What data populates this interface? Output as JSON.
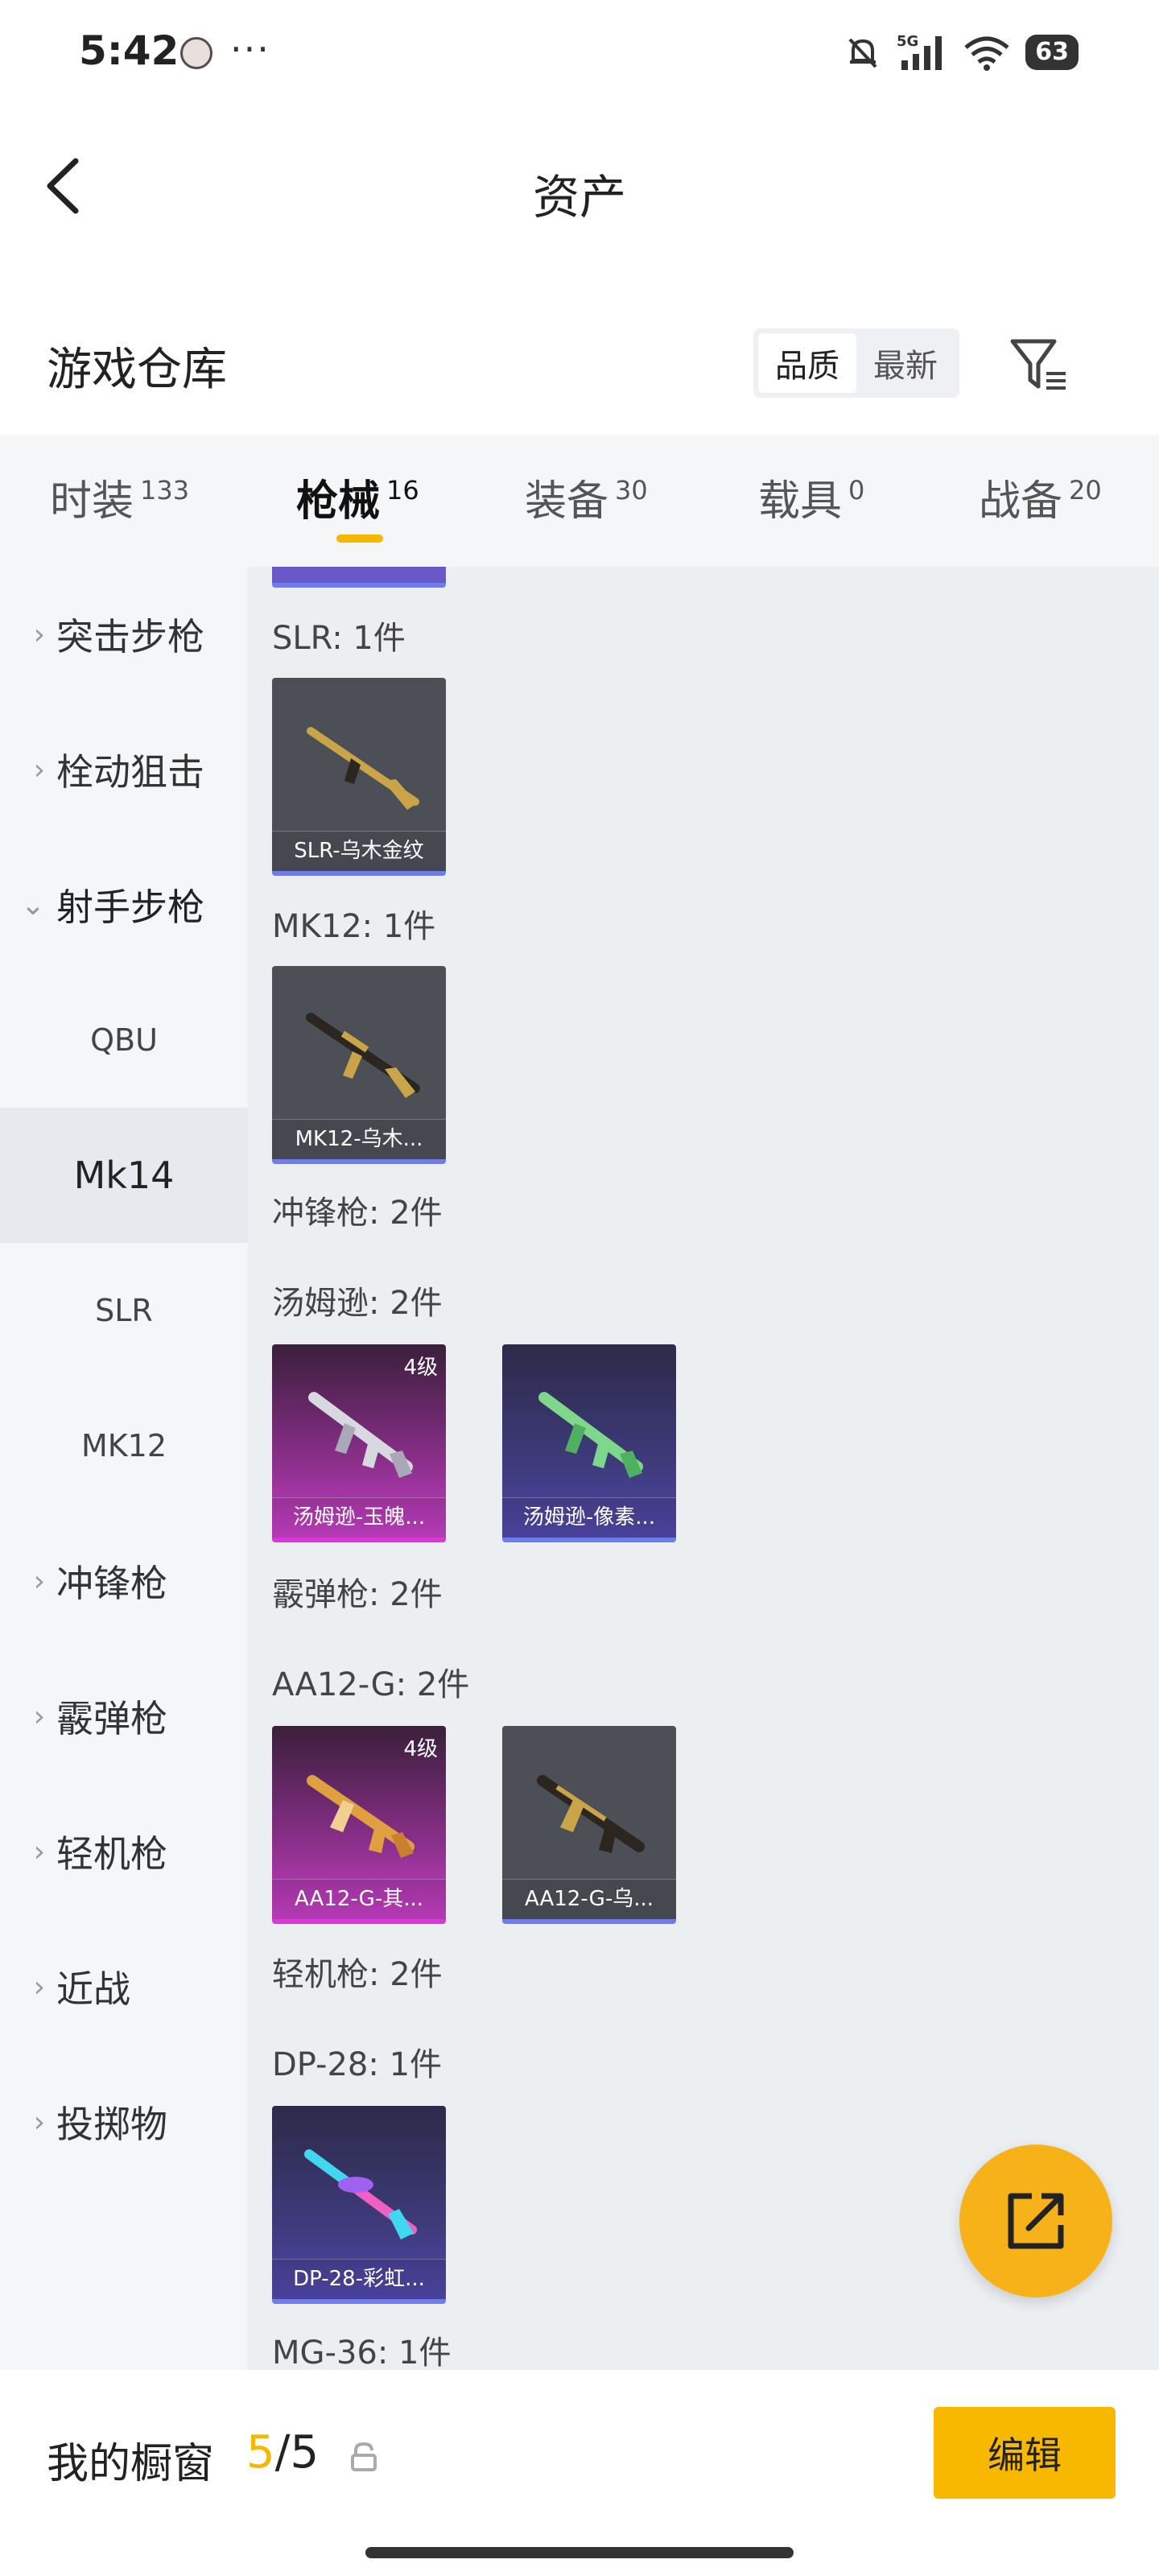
{
  "status_bar": {
    "time": "5:42",
    "more": "···",
    "network": "5G",
    "battery": "63"
  },
  "header": {
    "title": "资产"
  },
  "warehouse": {
    "title": "游戏仓库",
    "sort_options": [
      "品质",
      "最新"
    ],
    "sort_active": "品质"
  },
  "tabs": [
    {
      "label": "时装",
      "count": "133"
    },
    {
      "label": "枪械",
      "count": "16"
    },
    {
      "label": "装备",
      "count": "30"
    },
    {
      "label": "载具",
      "count": "0"
    },
    {
      "label": "战备",
      "count": "20"
    }
  ],
  "sidebar": {
    "items": [
      {
        "label": "突击步枪",
        "chevron": "›"
      },
      {
        "label": "栓动狙击",
        "chevron": "›"
      },
      {
        "label": "射手步枪",
        "chevron": "⌄"
      },
      {
        "label": "QBU"
      },
      {
        "label": "Mk14"
      },
      {
        "label": "SLR"
      },
      {
        "label": "MK12"
      },
      {
        "label": "冲锋枪",
        "chevron": "›"
      },
      {
        "label": "霰弹枪",
        "chevron": "›"
      },
      {
        "label": "轻机枪",
        "chevron": "›"
      },
      {
        "label": "近战",
        "chevron": "›"
      },
      {
        "label": "投掷物",
        "chevron": "›"
      }
    ]
  },
  "content": {
    "sections": [
      {
        "label": "SLR: 1件"
      },
      {
        "label": "MK12: 1件"
      },
      {
        "label": "冲锋枪: 2件"
      },
      {
        "label": "汤姆逊: 2件"
      },
      {
        "label": "霰弹枪: 2件"
      },
      {
        "label": "AA12-G: 2件"
      },
      {
        "label": "轻机枪: 2件"
      },
      {
        "label": "DP-28: 1件"
      },
      {
        "label": "MG-36: 1件"
      }
    ],
    "items": [
      {
        "name": "SLR-乌木金纹",
        "level": ""
      },
      {
        "name": "MK12-乌木...",
        "level": ""
      },
      {
        "name": "汤姆逊-玉魄...",
        "level": "4级"
      },
      {
        "name": "汤姆逊-像素...",
        "level": ""
      },
      {
        "name": "AA12-G-其...",
        "level": "4级"
      },
      {
        "name": "AA12-G-乌...",
        "level": ""
      },
      {
        "name": "DP-28-彩虹...",
        "level": ""
      }
    ]
  },
  "showcase": {
    "label": "我的橱窗",
    "current": "5",
    "separator": "/",
    "total": "5",
    "edit_label": "编辑"
  },
  "colors": {
    "accent": "#f5b700",
    "rarity_purple": "#6e7cf0",
    "rarity_pink": "#d838d8"
  }
}
